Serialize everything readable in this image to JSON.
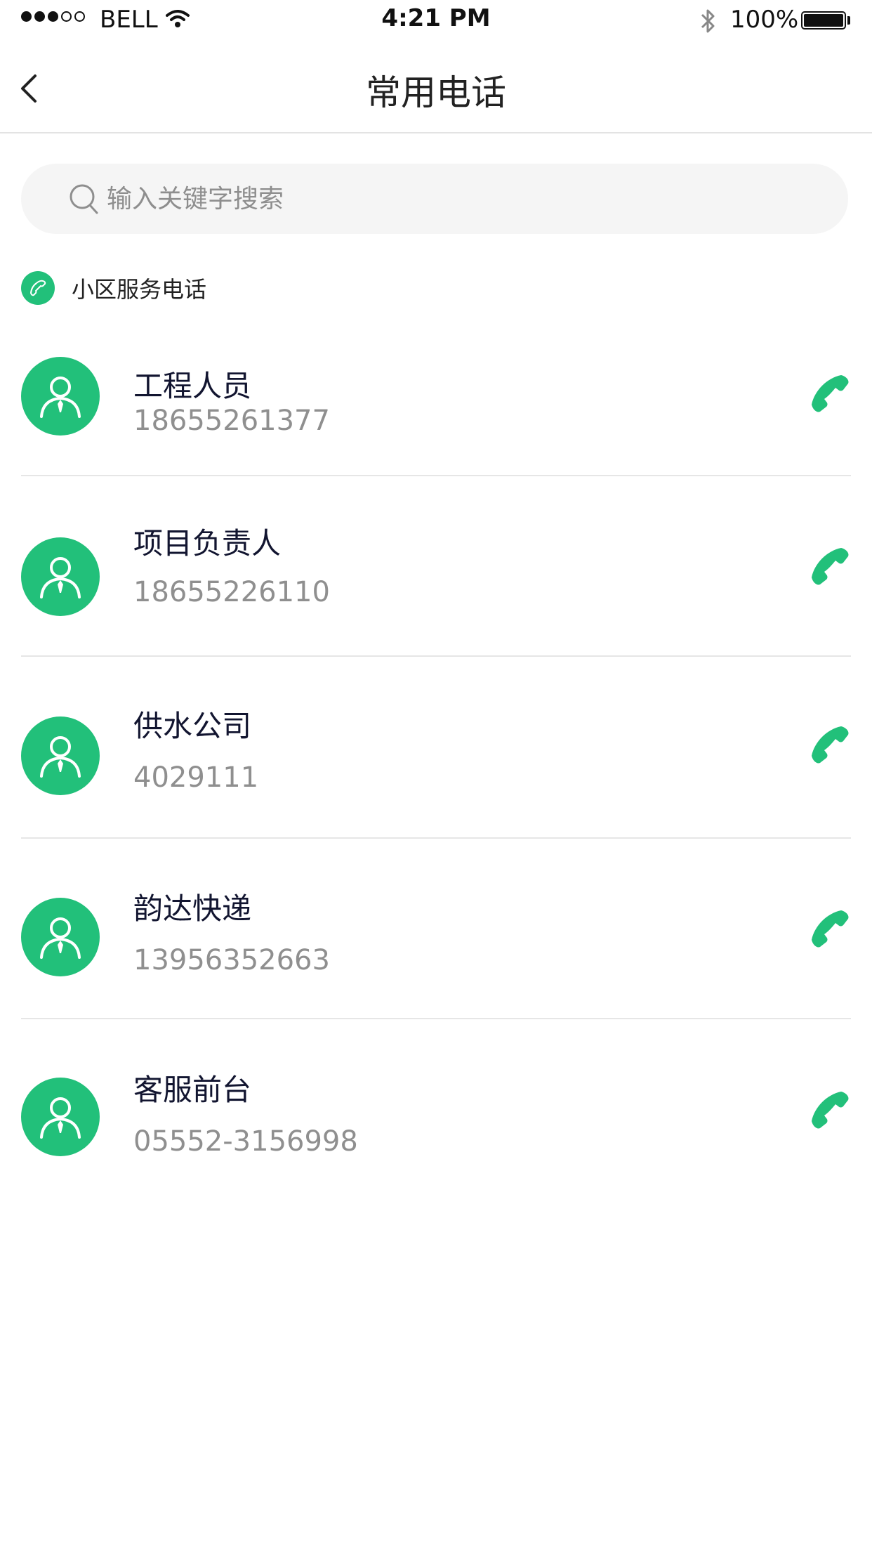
{
  "status_bar": {
    "carrier": "BELL",
    "time": "4:21 PM",
    "battery": "100%"
  },
  "nav": {
    "title": "常用电话",
    "back_icon": "chevron-left-icon"
  },
  "search": {
    "placeholder": "输入关键字搜索",
    "value": ""
  },
  "section": {
    "label": "小区服务电话",
    "icon": "phone-icon"
  },
  "contacts": [
    {
      "name": "工程人员",
      "phone": "18655261377"
    },
    {
      "name": "项目负责人",
      "phone": "18655226110"
    },
    {
      "name": "供水公司",
      "phone": "4029111"
    },
    {
      "name": "韵达快递",
      "phone": "13956352663"
    },
    {
      "name": "客服前台",
      "phone": "05552-3156998"
    }
  ],
  "colors": {
    "accent": "#22c07a",
    "name_text": "#121530",
    "phone_text": "#8f8f8f",
    "divider": "#e6e6e6"
  }
}
